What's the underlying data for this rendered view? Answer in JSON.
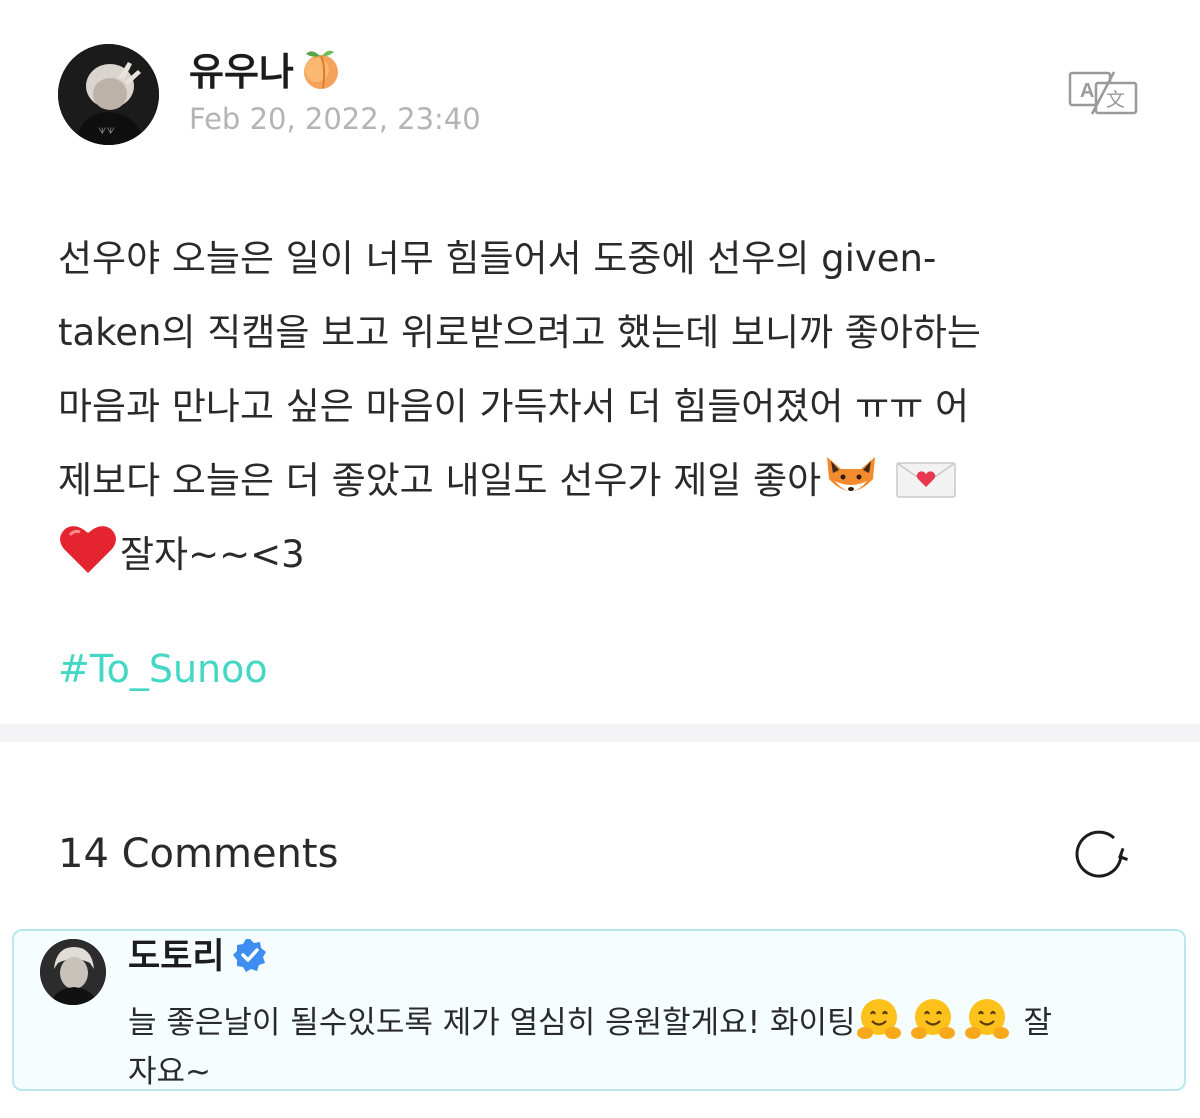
{
  "post": {
    "author": "유우나",
    "author_emoji": "peach-emoji",
    "timestamp": "Feb 20, 2022, 23:40",
    "translate_icon": "translate-icon",
    "body_lines": [
      "선우야 오늘은 일이 너무 힘들어서 도중에 선우의 given-",
      "taken의 직캠을 보고 위로받으려고 했는데 보니까 좋아하는",
      "마음과 만나고 싶은 마음이 가득차서 더 힘들어졌어 ㅠㅠ 어",
      "제보다 오늘은 더 좋았고 내일도 선우가 제일 좋아",
      "잘자~~<3"
    ],
    "body_emojis": [
      "fox-emoji",
      "love-letter-emoji",
      "red-heart-emoji"
    ],
    "hashtag": "#To_Sunoo"
  },
  "comments": {
    "count_label": "14 Comments",
    "refresh_icon": "refresh-icon",
    "items": [
      {
        "author": "도토리",
        "verified_icon": "verified-badge-icon",
        "text_lines": [
          "늘 좋은날이 될수있도록 제가 열심히 응원할게요! 화이팅",
          "자요~"
        ],
        "text_suffix": "잘",
        "emojis": [
          "hugging-face-emoji",
          "hugging-face-emoji",
          "hugging-face-emoji"
        ]
      }
    ]
  },
  "colors": {
    "hashtag": "#43d7c4",
    "timestamp": "#b4b4b4",
    "comment_border": "#b9e7ef",
    "comment_background": "#f5fdff",
    "divider": "#f3f3f5",
    "verified": "#3d8ef0"
  }
}
